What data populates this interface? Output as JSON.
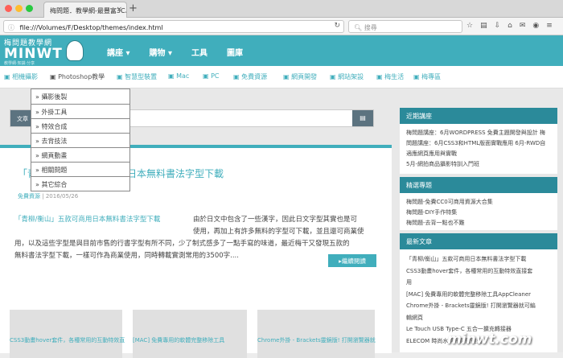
{
  "browser": {
    "tab_title": "梅問題．教學網-最豐富3C、旅遊...",
    "tab_close": "×",
    "new_tab": "+",
    "url": "file:///Volumes/F/Desktop/themes/index.html",
    "search_placeholder": "搜尋"
  },
  "header": {
    "logo_line1": "梅問題教學網",
    "logo_line2": "MINWT",
    "logo_line3": "教學網·知識·分享",
    "nav": [
      "講座 ▾",
      "購物 ▾",
      "工具",
      "圖庫"
    ]
  },
  "categories": [
    "相機攝影",
    "Photoshop教學",
    "智慧型裝置",
    "Mac",
    "PC",
    "免費資源",
    "網頁開發",
    "網站架設",
    "梅生活",
    "梅專區"
  ],
  "dropdown": [
    "攝影後製",
    "外掛工具",
    "特效合成",
    "去背技法",
    "網頁動畫",
    "相關問題",
    "其它綜合"
  ],
  "search": {
    "label": "文章",
    "button_icon": "search-icon"
  },
  "post": {
    "title": "「青柳/衡山」五款可商用日本無料書法字型下載",
    "meta_category": "免費資源",
    "meta_date": "2016/05/26",
    "link_text": "「青柳/衡山」五款可商用日本無料書法字型下載",
    "excerpt_line1": "由於日文中包含了一些漢字，因此日文字型其實也是可",
    "excerpt_line2": "使用，再加上有許多無料的字型可下載，並且還可商業使",
    "excerpt_line3": "用，以及這些字型是與目前市售的行書字型有所不同，少了制式感多了一點手寫的味道，最近梅干又發現五款的",
    "excerpt_line4": "無料書法字型下載，一樣可作為商業使用，同時轉載實測常用的3500字....",
    "more_button": "▸繼續閱讀"
  },
  "cards": [
    {
      "title": "CSS3動畫hover套件，各種常用的互動特效直"
    },
    {
      "title": "[MAC] 免費專用的軟體完整移除工具"
    },
    {
      "title": "Chrome外掛 - Brackets靈鏡版! 打開瀏覽器就"
    }
  ],
  "sidebar": {
    "box1": {
      "title": "近期講座",
      "lines": [
        "梅問題講座：6月WORDPRESS 免費主題開發與設計 梅",
        "問題講座：6月CSS3和HTML版面實戰應用 6月-RWD自",
        "適應網頁應用與實戰",
        "5月-網拍商品攝影特訓入門班"
      ]
    },
    "box2": {
      "title": "精選專題",
      "lines": [
        "梅問題-免費CC0可商用資源大合集",
        "梅問題-DIY手作特集",
        "梅問題-去背一點也不難"
      ]
    },
    "box3": {
      "title": "最新文章",
      "lines": [
        "「青柳/衡山」五款可商用日本無料書法字型下載",
        "CSS3動畫hover套件，各種常用的互動特效直接套",
        "用",
        "[MAC] 免費專用的軟體完整移除工具AppCleaner",
        "Chrome外掛 - Brackets靈鏡版! 打開瀏覽器就可編",
        "輯網頁",
        "Le Touch USB Type-C 五合一擴充轉接器",
        "ELECOM 時尚水柄布萊爾鍵盤"
      ]
    }
  },
  "watermark": "minwt.com",
  "colors": {
    "brand": "#40aebc",
    "brand_dark": "#2b8a9a",
    "search_button": "#5c7380"
  }
}
